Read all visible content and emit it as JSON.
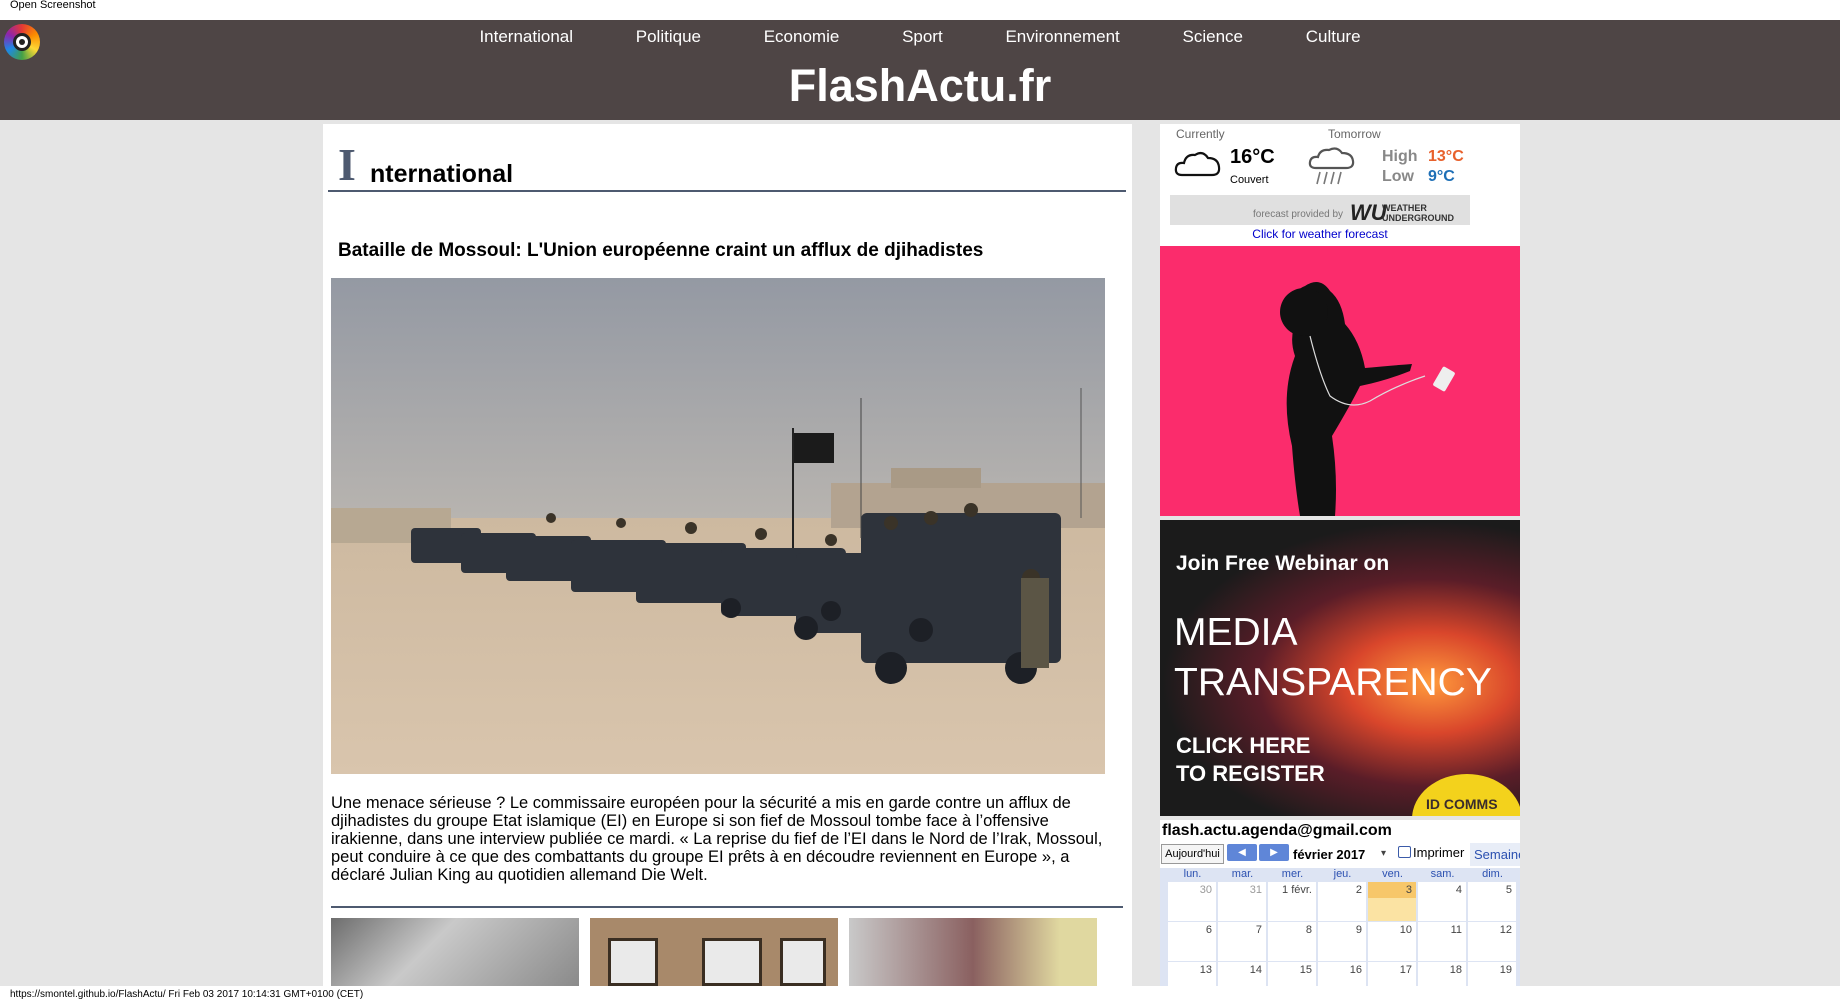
{
  "browser": {
    "top_label": "Open Screenshot",
    "status_text": "https://smontel.github.io/FlashActu/ Fri Feb 03 2017 10:14:31 GMT+0100 (CET)"
  },
  "header": {
    "site_title": "FlashActu.fr",
    "nav": [
      "International",
      "Politique",
      "Economie",
      "Sport",
      "Environnement",
      "Science",
      "Culture"
    ]
  },
  "section": {
    "initial": "I",
    "rest": "nternational"
  },
  "article": {
    "title": "Bataille de Mossoul: L'Union européenne craint un afflux de djihadistes",
    "body": "Une menace sérieuse ? Le commissaire européen pour la sécurité a mis en garde contre un afflux de djihadistes du groupe Etat islamique (EI) en Europe si son fief de Mossoul tombe face à l’offensive irakienne, dans une interview publiée ce mardi. « La reprise du fief de l’EI dans le Nord de l’Irak, Mossoul, peut conduire à ce que des combattants du groupe EI prêts à en découdre reviennent en Europe », a déclaré Julian King au quotidien allemand Die Welt."
  },
  "weather": {
    "currently_label": "Currently",
    "tomorrow_label": "Tomorrow",
    "current_temp": "16°C",
    "current_condition": "Couvert",
    "high_label": "High",
    "high_value": "13°C",
    "low_label": "Low",
    "low_value": "9°C",
    "provider_text": "forecast provided by",
    "provider_logo": "WU",
    "provider_name": "WEATHER UNDERGROUND",
    "link": "Click for weather forecast",
    "colors": {
      "high": "#e8612c",
      "low": "#1e6fb6"
    }
  },
  "ads": {
    "music_ad_color": "#fb2c6c",
    "webinar": {
      "line1": "Join Free Webinar on",
      "line2a": "MEDIA",
      "line2b": "TRANSPARENCY",
      "line3a": "CLICK HERE",
      "line3b": "TO REGISTER",
      "badge": "ID COMMS"
    }
  },
  "calendar": {
    "email": "flash.actu.agenda@gmail.com",
    "today_button": "Aujourd'hui",
    "prev_icon": "◀",
    "next_icon": "▶",
    "month": "février 2017",
    "dropdown_icon": "▾",
    "print_label": "Imprimer",
    "week_tab": "Semaine",
    "days": [
      "lun.",
      "mar.",
      "mer.",
      "jeu.",
      "ven.",
      "sam.",
      "dim."
    ],
    "weeks": [
      [
        "30",
        "31",
        "1 févr.",
        "2",
        "3",
        "4",
        "5"
      ],
      [
        "6",
        "7",
        "8",
        "9",
        "10",
        "11",
        "12"
      ],
      [
        "13",
        "14",
        "15",
        "16",
        "17",
        "18",
        "19"
      ]
    ],
    "today": "3"
  }
}
